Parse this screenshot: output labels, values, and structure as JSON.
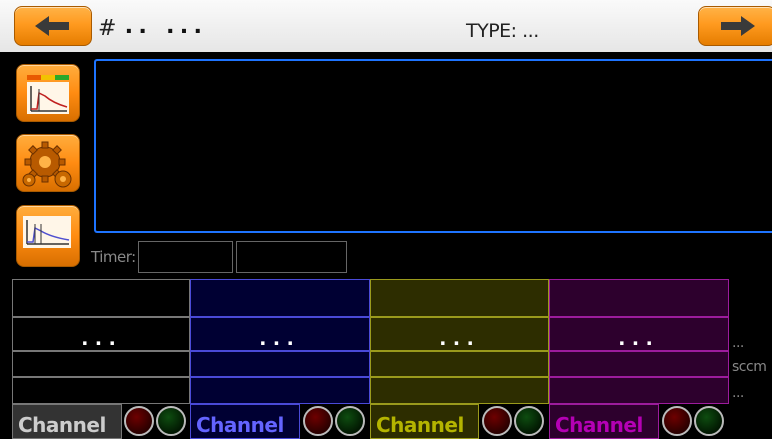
{
  "header": {
    "back_icon": "left-arrow-icon",
    "next_icon": "right-arrow-icon",
    "number_prefix": "#",
    "number_value": "..  ...",
    "type_label": "TYPE: ..."
  },
  "sidebar": {
    "items": [
      {
        "icon": "graph-gauge-icon"
      },
      {
        "icon": "gears-icon"
      },
      {
        "icon": "graph-icon"
      }
    ]
  },
  "timer": {
    "label": "Timer:",
    "value1": "",
    "value2": ""
  },
  "units": {
    "top": "...",
    "middle": "sccm",
    "bottom": "..."
  },
  "channels": [
    {
      "label": "Channel",
      "value": "...",
      "color": "#777777",
      "bg": "#000000",
      "label_color": "#cccccc"
    },
    {
      "label": "Channel",
      "value": "...",
      "color": "#4a4ad8",
      "bg": "#000033",
      "label_color": "#6464ff"
    },
    {
      "label": "Channel",
      "value": "...",
      "color": "#9a9a1c",
      "bg": "#2d2d00",
      "label_color": "#b4b400"
    },
    {
      "label": "Channel",
      "value": "...",
      "color": "#9c1c9c",
      "bg": "#2d002d",
      "label_color": "#b400b4"
    }
  ],
  "colors": {
    "accent_orange": "#ff9a1f",
    "display_border": "#1e74ff"
  }
}
